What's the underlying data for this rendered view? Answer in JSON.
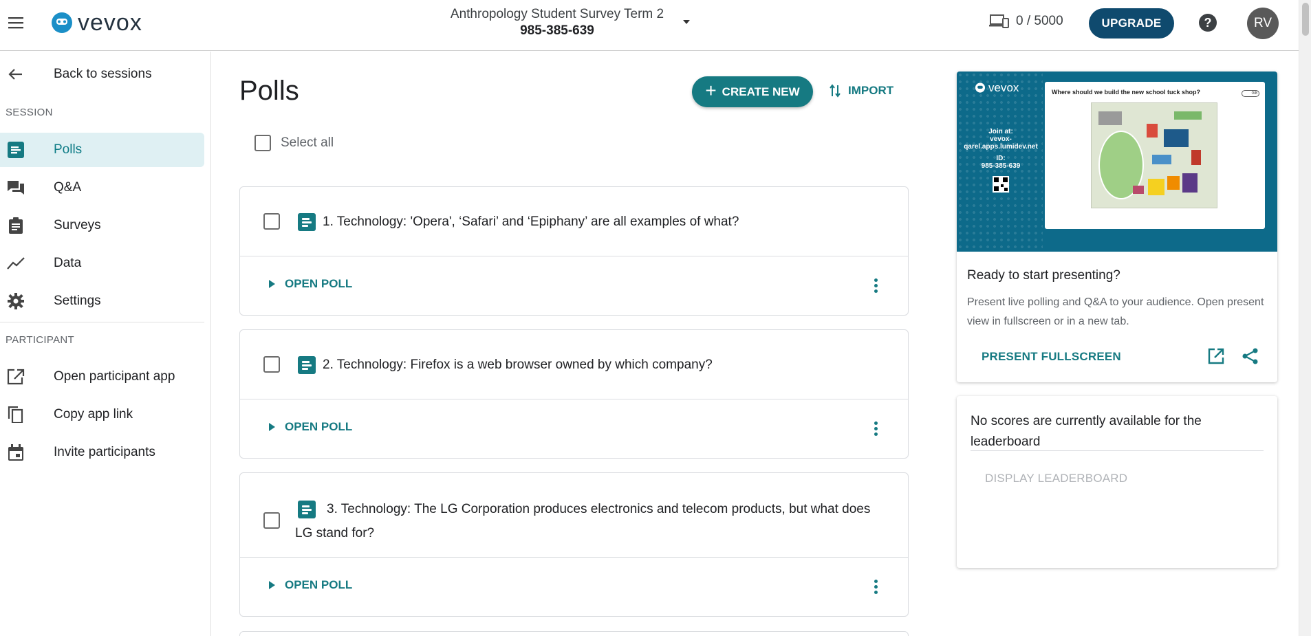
{
  "header": {
    "logo_text": "vevox",
    "session_name": "Anthropology Student Survey Term 2",
    "session_code": "985-385-639",
    "participants": "0 / 5000",
    "upgrade_label": "UPGRADE",
    "help_symbol": "?",
    "avatar_initials": "RV"
  },
  "sidebar": {
    "back_label": "Back to sessions",
    "session_section": "SESSION",
    "session_items": [
      {
        "label": "Polls",
        "icon": "poll-icon",
        "active": true
      },
      {
        "label": "Q&A",
        "icon": "forum-icon"
      },
      {
        "label": "Surveys",
        "icon": "clipboard-icon"
      },
      {
        "label": "Data",
        "icon": "trend-icon"
      },
      {
        "label": "Settings",
        "icon": "gear-icon"
      }
    ],
    "participant_section": "PARTICIPANT",
    "participant_items": [
      {
        "label": "Open participant app",
        "icon": "external-link-icon"
      },
      {
        "label": "Copy app link",
        "icon": "copy-icon"
      },
      {
        "label": "Invite participants",
        "icon": "calendar-icon"
      }
    ]
  },
  "main": {
    "title": "Polls",
    "create_label": "CREATE NEW",
    "import_label": "IMPORT",
    "select_all_label": "Select all",
    "open_poll_label": "OPEN POLL",
    "polls": [
      {
        "text": "1. Technology: 'Opera', ‘Safari’ and ‘Epiphany’ are all examples of what?"
      },
      {
        "text": "2. Technology: Firefox is a web browser owned by which company?"
      },
      {
        "text": "3. Technology: The LG Corporation produces electronics and telecom products, but what does LG stand for?"
      }
    ]
  },
  "present": {
    "preview_logo": "vevox",
    "preview_join": "Join at:",
    "preview_url": "vevox-qarel.apps.lumidev.net",
    "preview_id_label": "ID:",
    "preview_id": "985-385-639",
    "preview_question": "Where should we build the new school tuck shop?",
    "preview_badge": "0/8",
    "title": "Ready to start presenting?",
    "description": "Present live polling and Q&A to your audience. Open present view in fullscreen or in a new tab.",
    "fullscreen_label": "PRESENT FULLSCREEN"
  },
  "leaderboard": {
    "message": "No scores are currently available for the leaderboard",
    "button_label": "DISPLAY LEADERBOARD"
  },
  "colors": {
    "accent": "#167a82",
    "upgrade": "#0f4a6e",
    "active_bg": "#dff0f3"
  }
}
